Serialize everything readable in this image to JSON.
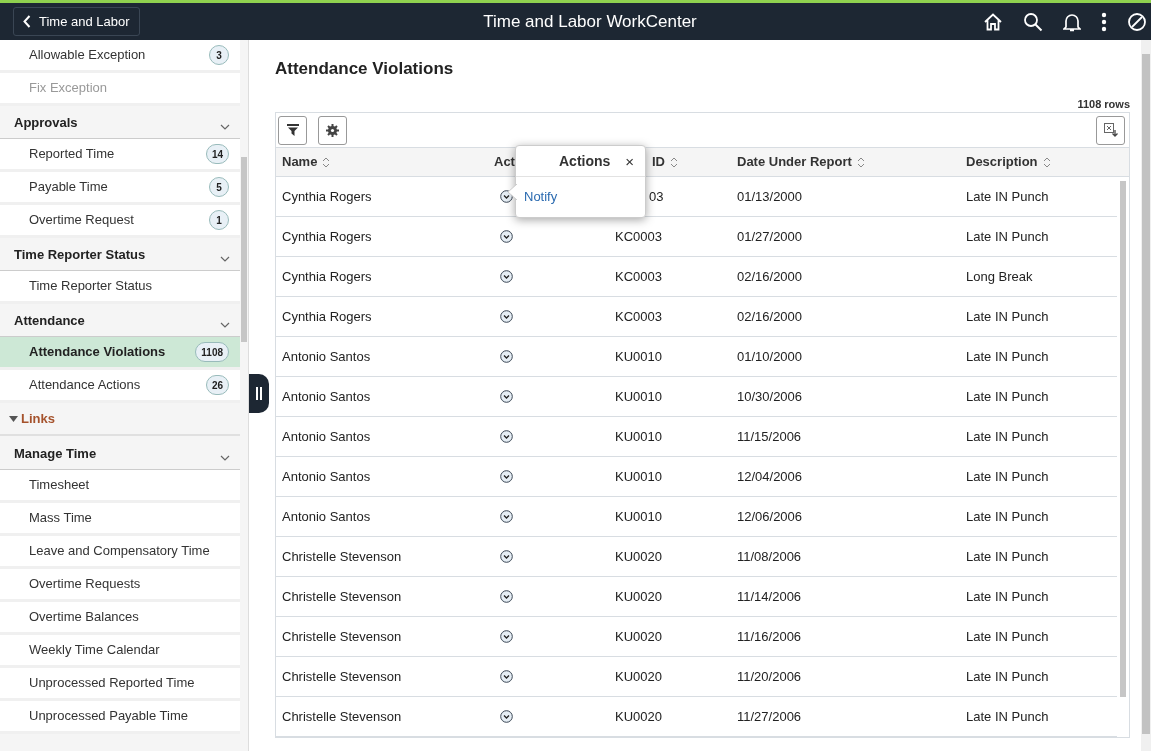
{
  "header": {
    "back_label": "Time and Labor",
    "title": "Time and Labor WorkCenter"
  },
  "sidebar": {
    "items": [
      {
        "kind": "item",
        "label": "Allowable Exception",
        "badge": "3",
        "selected": false,
        "disabled": false
      },
      {
        "kind": "item",
        "label": "Fix Exception",
        "selected": false,
        "disabled": true
      },
      {
        "kind": "group",
        "label": "Approvals"
      },
      {
        "kind": "item",
        "label": "Reported Time",
        "badge": "14",
        "selected": false,
        "disabled": false
      },
      {
        "kind": "item",
        "label": "Payable Time",
        "badge": "5",
        "selected": false,
        "disabled": false
      },
      {
        "kind": "item",
        "label": "Overtime Request",
        "badge": "1",
        "selected": false,
        "disabled": false
      },
      {
        "kind": "group",
        "label": "Time Reporter Status"
      },
      {
        "kind": "item",
        "label": "Time Reporter Status",
        "selected": false,
        "disabled": false
      },
      {
        "kind": "group",
        "label": "Attendance"
      },
      {
        "kind": "item",
        "label": "Attendance Violations",
        "badge": "1108",
        "selected": true,
        "disabled": false
      },
      {
        "kind": "item",
        "label": "Attendance Actions",
        "badge": "26",
        "selected": false,
        "disabled": false
      },
      {
        "kind": "section",
        "label": "Links"
      },
      {
        "kind": "group",
        "label": "Manage Time"
      },
      {
        "kind": "item",
        "label": "Timesheet",
        "selected": false,
        "disabled": false
      },
      {
        "kind": "item",
        "label": "Mass Time",
        "selected": false,
        "disabled": false
      },
      {
        "kind": "item",
        "label": "Leave and Compensatory Time",
        "selected": false,
        "disabled": false
      },
      {
        "kind": "item",
        "label": "Overtime Requests",
        "selected": false,
        "disabled": false
      },
      {
        "kind": "item",
        "label": "Overtime Balances",
        "selected": false,
        "disabled": false
      },
      {
        "kind": "item",
        "label": "Weekly Time Calendar",
        "selected": false,
        "disabled": false
      },
      {
        "kind": "item",
        "label": "Unprocessed Reported Time",
        "selected": false,
        "disabled": false
      },
      {
        "kind": "item",
        "label": "Unprocessed Payable Time",
        "selected": false,
        "disabled": false
      }
    ]
  },
  "page": {
    "title": "Attendance Violations",
    "row_count": "1108 rows"
  },
  "table": {
    "columns": [
      "Name",
      "Act",
      "ID",
      "Date Under Report",
      "Description"
    ],
    "rows": [
      [
        "Cynthia Rogers",
        "",
        "03",
        "01/13/2000",
        "Late IN Punch"
      ],
      [
        "Cynthia Rogers",
        "",
        "KC0003",
        "01/27/2000",
        "Late IN Punch"
      ],
      [
        "Cynthia Rogers",
        "",
        "KC0003",
        "02/16/2000",
        "Long Break"
      ],
      [
        "Cynthia Rogers",
        "",
        "KC0003",
        "02/16/2000",
        "Late IN Punch"
      ],
      [
        "Antonio Santos",
        "",
        "KU0010",
        "01/10/2000",
        "Late IN Punch"
      ],
      [
        "Antonio Santos",
        "",
        "KU0010",
        "10/30/2006",
        "Late IN Punch"
      ],
      [
        "Antonio Santos",
        "",
        "KU0010",
        "11/15/2006",
        "Late IN Punch"
      ],
      [
        "Antonio Santos",
        "",
        "KU0010",
        "12/04/2006",
        "Late IN Punch"
      ],
      [
        "Antonio Santos",
        "",
        "KU0010",
        "12/06/2006",
        "Late IN Punch"
      ],
      [
        "Christelle Stevenson",
        "",
        "KU0020",
        "11/08/2006",
        "Late IN Punch"
      ],
      [
        "Christelle Stevenson",
        "",
        "KU0020",
        "11/14/2006",
        "Late IN Punch"
      ],
      [
        "Christelle Stevenson",
        "",
        "KU0020",
        "11/16/2006",
        "Late IN Punch"
      ],
      [
        "Christelle Stevenson",
        "",
        "KU0020",
        "11/20/2006",
        "Late IN Punch"
      ],
      [
        "Christelle Stevenson",
        "",
        "KU0020",
        "11/27/2006",
        "Late IN Punch"
      ]
    ]
  },
  "popover": {
    "title": "Actions",
    "close": "×",
    "items": [
      "Notify"
    ]
  }
}
